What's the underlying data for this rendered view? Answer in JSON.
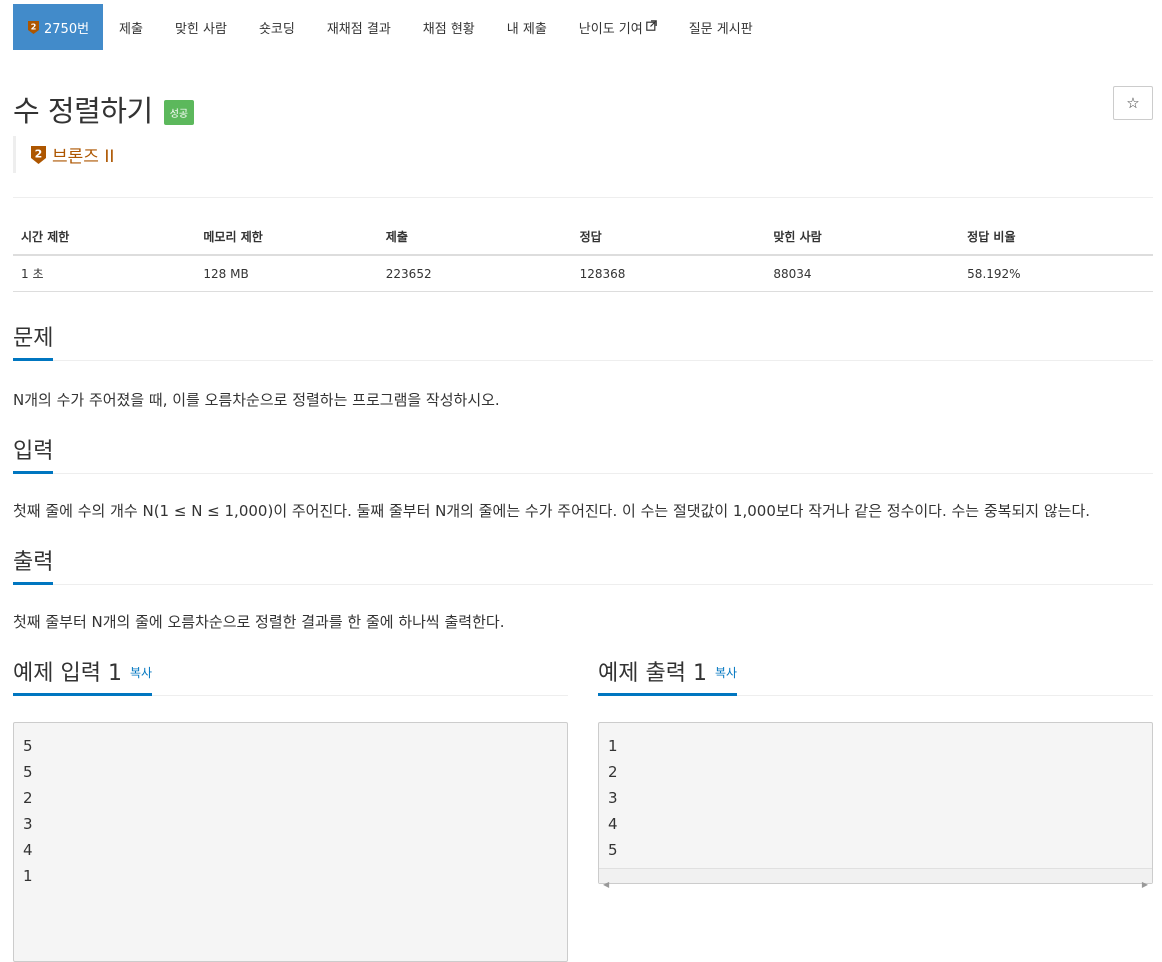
{
  "nav": {
    "problem_number": "2750번",
    "items": [
      "제출",
      "맞힌 사람",
      "숏코딩",
      "재채점 결과",
      "채점 현황",
      "내 제출",
      "난이도 기여",
      "질문 게시판"
    ]
  },
  "problem": {
    "title": "수 정렬하기",
    "result_label": "성공",
    "star": "☆",
    "tier_level": "2",
    "tier_name": "브론즈 II",
    "tier_color": "#ad5600"
  },
  "info_table": {
    "headers": [
      "시간 제한",
      "메모리 제한",
      "제출",
      "정답",
      "맞힌 사람",
      "정답 비율"
    ],
    "row": [
      "1 초",
      "128 MB",
      "223652",
      "128368",
      "88034",
      "58.192%"
    ]
  },
  "sections": {
    "description_title": "문제",
    "description": "N개의 수가 주어졌을 때, 이를 오름차순으로 정렬하는 프로그램을 작성하시오.",
    "input_title": "입력",
    "input": "첫째 줄에 수의 개수 N(1 ≤ N ≤ 1,000)이 주어진다. 둘째 줄부터 N개의 줄에는 수가 주어진다. 이 수는 절댓값이 1,000보다 작거나 같은 정수이다. 수는 중복되지 않는다.",
    "output_title": "출력",
    "output": "첫째 줄부터 N개의 줄에 오름차순으로 정렬한 결과를 한 줄에 하나씩 출력한다."
  },
  "samples": {
    "input_title": "예제 입력 1",
    "output_title": "예제 출력 1",
    "copy_label": "복사",
    "input_lines": [
      "5",
      "5",
      "2",
      "3",
      "4",
      "1"
    ],
    "output_lines": [
      "1",
      "2",
      "3",
      "4",
      "5"
    ]
  },
  "colors": {
    "accent": "#428bca",
    "success": "#5cb85c",
    "link": "#0076c0"
  }
}
